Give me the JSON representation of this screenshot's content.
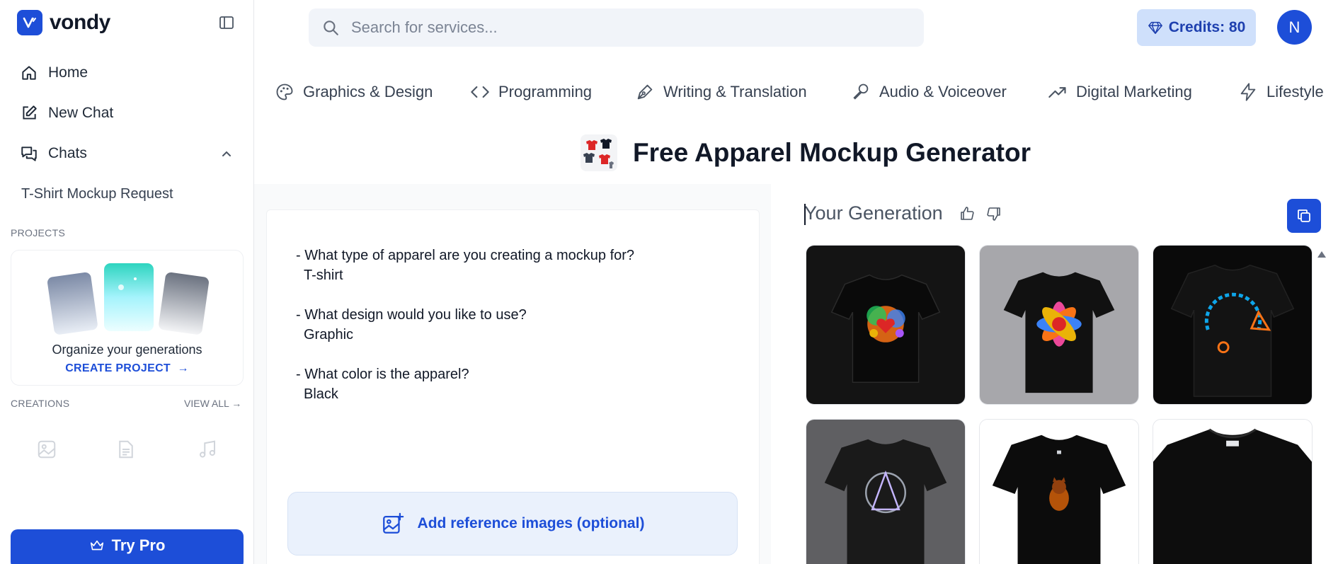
{
  "brand": {
    "name": "vondy",
    "accent": "#1d4ed8"
  },
  "sidebar": {
    "nav": [
      {
        "label": "Home",
        "icon": "home-icon"
      },
      {
        "label": "New Chat",
        "icon": "edit-icon"
      },
      {
        "label": "Chats",
        "icon": "chat-icon"
      }
    ],
    "chats": [
      "T-Shirt Mockup Request"
    ],
    "projects_label": "PROJECTS",
    "project_card": {
      "title": "Organize your generations",
      "cta": "CREATE PROJECT"
    },
    "creations_label": "CREATIONS",
    "view_all": "VIEW ALL",
    "creation_icons": [
      "image-icon",
      "document-icon",
      "music-icon"
    ],
    "try_pro": "Try Pro"
  },
  "header": {
    "search_placeholder": "Search for services...",
    "credits": "Credits: 80",
    "avatar_initial": "N"
  },
  "categories": [
    {
      "label": "Graphics & Design",
      "icon": "palette-icon"
    },
    {
      "label": "Programming",
      "icon": "code-icon"
    },
    {
      "label": "Writing & Translation",
      "icon": "pen-icon"
    },
    {
      "label": "Audio & Voiceover",
      "icon": "microphone-icon"
    },
    {
      "label": "Digital Marketing",
      "icon": "trending-icon"
    },
    {
      "label": "Lifestyle",
      "icon": "lightning-icon"
    }
  ],
  "page": {
    "title": "Free Apparel Mockup Generator"
  },
  "form": {
    "qa": [
      {
        "q": "- What type of apparel are you creating a mockup for?",
        "a": "T-shirt"
      },
      {
        "q": "- What design would you like to use?",
        "a": "Graphic"
      },
      {
        "q": "- What color is the apparel?",
        "a": "Black"
      }
    ],
    "reference_button": "Add reference images (optional)"
  },
  "generation": {
    "title": "Your Generation",
    "images": [
      {
        "alt": "black t-shirt with colorful splash heart graphic"
      },
      {
        "alt": "black t-shirt with colorful flower graphic"
      },
      {
        "alt": "black t-shirt with circular text graphic"
      },
      {
        "alt": "black t-shirt with triangle circle emblem"
      },
      {
        "alt": "black t-shirt with small cat graphic"
      },
      {
        "alt": "plain black t-shirt"
      }
    ]
  }
}
